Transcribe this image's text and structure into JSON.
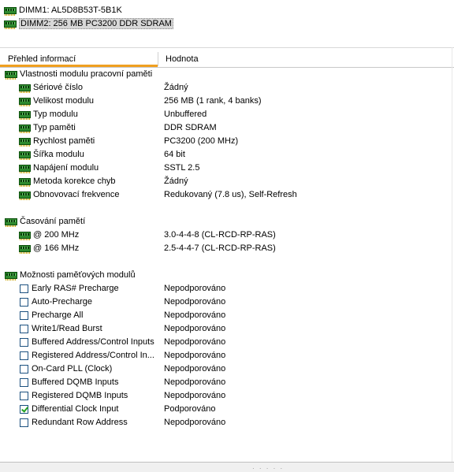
{
  "dimms": [
    {
      "label": "DIMM1: AL5D8B53T-5B1K",
      "selected": false
    },
    {
      "label": "DIMM2: 256 MB PC3200 DDR SDRAM",
      "selected": true
    }
  ],
  "columns": {
    "field": "Přehled informací",
    "value": "Hodnota"
  },
  "groups": [
    {
      "title": "Vlastnosti modulu pracovní paměti",
      "kind": "ram",
      "items": [
        {
          "label": "Sériové číslo",
          "value": "Žádný"
        },
        {
          "label": "Velikost modulu",
          "value": "256 MB (1 rank, 4 banks)"
        },
        {
          "label": "Typ modulu",
          "value": "Unbuffered"
        },
        {
          "label": "Typ paměti",
          "value": "DDR SDRAM"
        },
        {
          "label": "Rychlost paměti",
          "value": "PC3200 (200 MHz)"
        },
        {
          "label": "Šířka modulu",
          "value": "64 bit"
        },
        {
          "label": "Napájení modulu",
          "value": "SSTL 2.5"
        },
        {
          "label": "Metoda korekce chyb",
          "value": "Žádný"
        },
        {
          "label": "Obnovovací frekvence",
          "value": "Redukovaný (7.8 us), Self-Refresh"
        }
      ]
    },
    {
      "title": "Časování pamětí",
      "kind": "ram",
      "items": [
        {
          "label": "@ 200 MHz",
          "value": "3.0-4-4-8  (CL-RCD-RP-RAS)"
        },
        {
          "label": "@ 166 MHz",
          "value": "2.5-4-4-7  (CL-RCD-RP-RAS)"
        }
      ]
    },
    {
      "title": "Možnosti paměťových modulů",
      "kind": "checkbox",
      "items": [
        {
          "label": "Early RAS# Precharge",
          "value": "Nepodporováno",
          "checked": false
        },
        {
          "label": "Auto-Precharge",
          "value": "Nepodporováno",
          "checked": false
        },
        {
          "label": "Precharge All",
          "value": "Nepodporováno",
          "checked": false
        },
        {
          "label": "Write1/Read Burst",
          "value": "Nepodporováno",
          "checked": false
        },
        {
          "label": "Buffered Address/Control Inputs",
          "value": "Nepodporováno",
          "checked": false
        },
        {
          "label": "Registered Address/Control In...",
          "value": "Nepodporováno",
          "checked": false
        },
        {
          "label": "On-Card PLL (Clock)",
          "value": "Nepodporováno",
          "checked": false
        },
        {
          "label": "Buffered DQMB Inputs",
          "value": "Nepodporováno",
          "checked": false
        },
        {
          "label": "Registered DQMB Inputs",
          "value": "Nepodporováno",
          "checked": false
        },
        {
          "label": "Differential Clock Input",
          "value": "Podporováno",
          "checked": true
        },
        {
          "label": "Redundant Row Address",
          "value": "Nepodporováno",
          "checked": false
        }
      ]
    }
  ],
  "icons": {
    "module": "ram-module-icon",
    "checkbox": "checkbox-icon"
  },
  "colors": {
    "accent": "#f0a020",
    "selection": "#d8d8d8",
    "check": "#21a121"
  }
}
